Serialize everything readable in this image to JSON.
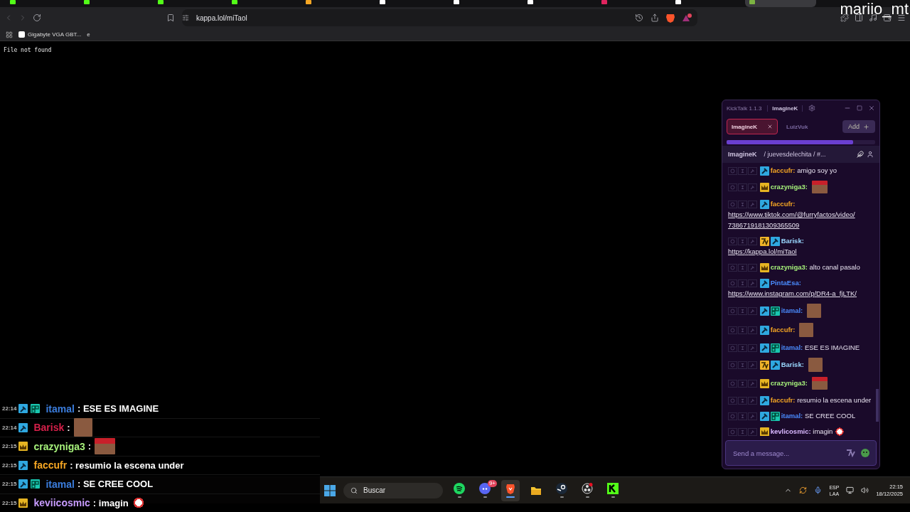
{
  "browser": {
    "tabs": [
      {
        "color": "#53fc18",
        "selected": false
      },
      {
        "color": "#53fc18",
        "selected": false
      },
      {
        "color": "#53fc18",
        "selected": false
      },
      {
        "color": "#53fc18",
        "selected": false
      },
      {
        "color": "#f5a623",
        "selected": false
      },
      {
        "color": "#ffffff",
        "selected": false
      },
      {
        "color": "#ffffff",
        "selected": false
      },
      {
        "color": "#ffffff",
        "selected": false
      },
      {
        "color": "#e0245e",
        "selected": false
      },
      {
        "color": "#ffffff",
        "selected": false
      },
      {
        "color": "#7cb342",
        "selected": true
      }
    ],
    "address": "kappa.lol/miTaol",
    "bookmarks": [
      "Gigabyte VGA GBT...",
      "e"
    ],
    "page_text": "File not found"
  },
  "overlay_name": "mariio_mt",
  "kicktalk": {
    "title": "KickTalk 1.1.3",
    "user": "ImagineK",
    "chat_tabs": [
      {
        "label": "ImagineK",
        "selected": true
      },
      {
        "label": "LuizVuk",
        "selected": false
      }
    ],
    "add_button": "Add",
    "progress": {
      "level": 0.85
    },
    "channel": "ImagineK",
    "channel_path": "/ juevesdelechita / #...",
    "messages": [
      {
        "badges": [
          {
            "kind": "mod"
          }
        ],
        "user": "faccufr:",
        "color": "#f5a623",
        "text": "amigo soy yo"
      },
      {
        "badges": [
          {
            "kind": "sub"
          }
        ],
        "user": "crazyniga3:",
        "color": "#a5f07a",
        "emote": {
          "kind": "santa"
        }
      },
      {
        "badges": [
          {
            "kind": "mod"
          }
        ],
        "user": "faccufr:",
        "color": "#f5a623",
        "link": "https://www.tiktok.com/@furryfactos/video/7386719181309365509"
      },
      {
        "badges": [
          {
            "kind": "seventv"
          },
          {
            "kind": "mod"
          }
        ],
        "user": "Barisk:",
        "color": "#9ad8ff",
        "link": "https://kappa.lol/miTaol"
      },
      {
        "badges": [
          {
            "kind": "sub"
          }
        ],
        "user": "crazyniga3:",
        "color": "#a5f07a",
        "text": "alto canal pasalo"
      },
      {
        "badges": [
          {
            "kind": "mod"
          }
        ],
        "user": "PintaEsa:",
        "color": "#4a8cff",
        "link": "https://www.instagram.com/p/DR4-a_fjLTK/"
      },
      {
        "badges": [
          {
            "kind": "mod"
          },
          {
            "kind": "og"
          }
        ],
        "user": "itamal:",
        "color": "#4a8cff",
        "emote": {
          "kind": "photo"
        }
      },
      {
        "badges": [
          {
            "kind": "mod"
          }
        ],
        "user": "faccufr:",
        "color": "#f5a623",
        "emote": {
          "kind": "photo"
        }
      },
      {
        "badges": [
          {
            "kind": "mod"
          },
          {
            "kind": "og"
          }
        ],
        "user": "itamal:",
        "color": "#4a8cff",
        "text": "ESE ES IMAGINE"
      },
      {
        "badges": [
          {
            "kind": "seventv"
          },
          {
            "kind": "mod"
          }
        ],
        "user": "Barisk:",
        "color": "#9ad8ff",
        "emote": {
          "kind": "photo"
        }
      },
      {
        "badges": [
          {
            "kind": "sub"
          }
        ],
        "user": "crazyniga3:",
        "color": "#a5f07a",
        "emote": {
          "kind": "santa"
        }
      },
      {
        "badges": [
          {
            "kind": "mod"
          }
        ],
        "user": "faccufr:",
        "color": "#f5a623",
        "text": "resumio la escena under"
      },
      {
        "badges": [
          {
            "kind": "mod"
          },
          {
            "kind": "og"
          }
        ],
        "user": "itamal:",
        "color": "#4a8cff",
        "text": "SE CREE COOL"
      },
      {
        "badges": [
          {
            "kind": "sub"
          }
        ],
        "user": "kevlicosmic:",
        "color": "#d9b8ff",
        "text": "imagin",
        "emote": {
          "kind": "creature"
        }
      }
    ],
    "input": {
      "placeholder": "Send a message..."
    }
  },
  "stream_chat": [
    {
      "time": "22:14",
      "badges": [
        {
          "kind": "mod"
        },
        {
          "kind": "og"
        }
      ],
      "user": "itamal",
      "color": "#3b7ddd",
      "text": ": ESE ES IMAGINE"
    },
    {
      "time": "22:14",
      "badges": [
        {
          "kind": "mod"
        }
      ],
      "user": "Barisk",
      "color": "#d6204a",
      "text": ":",
      "emote": {
        "kind": "photo"
      }
    },
    {
      "time": "22:15",
      "badges": [
        {
          "kind": "sub"
        }
      ],
      "user": "crazyniga3",
      "color": "#a5f07a",
      "text": ":",
      "emote": {
        "kind": "santa"
      }
    },
    {
      "time": "22:15",
      "badges": [
        {
          "kind": "mod"
        }
      ],
      "user": "faccufr",
      "color": "#f5a623",
      "text": ": resumio la escena under"
    },
    {
      "time": "22:15",
      "badges": [
        {
          "kind": "mod"
        },
        {
          "kind": "og"
        }
      ],
      "user": "itamal",
      "color": "#3b7ddd",
      "text": ": SE CREE COOL"
    },
    {
      "time": "22:15",
      "badges": [
        {
          "kind": "sub"
        }
      ],
      "user": "keviicosmic",
      "color": "#c79bff",
      "text": ": imagin",
      "emote": {
        "kind": "creature"
      }
    }
  ],
  "taskbar": {
    "search": {
      "placeholder": "Buscar"
    },
    "apps": [
      {
        "kind": "spotify",
        "running": true
      },
      {
        "kind": "discord",
        "running": true,
        "badge": "9+"
      },
      {
        "kind": "brave",
        "running": true,
        "selected": true
      },
      {
        "kind": "folder",
        "running": false
      },
      {
        "kind": "steam",
        "running": true
      },
      {
        "kind": "obs",
        "running": true
      },
      {
        "kind": "kick",
        "running": true
      }
    ],
    "language": "ESP",
    "layout": "LAA",
    "time": "22:15",
    "date": "18/12/2025"
  }
}
